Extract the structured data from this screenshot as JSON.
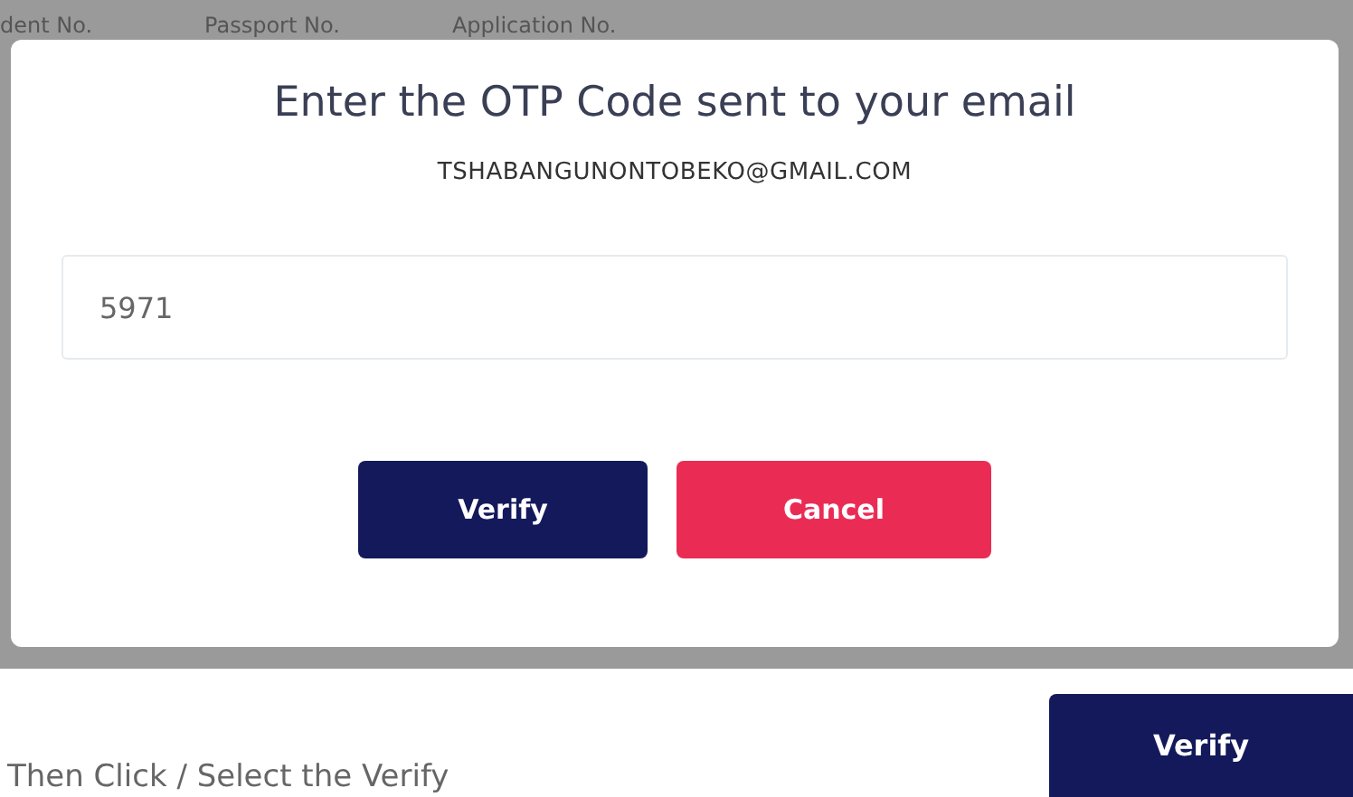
{
  "background_columns": [
    "dent No.",
    "Passport No.",
    "Application No."
  ],
  "dialog": {
    "title": "Enter the OTP Code sent to your email",
    "email": "TSHABANGUNONTOBEKO@GMAIL.COM",
    "otp_field": {
      "value": "5971"
    },
    "buttons": [
      {
        "label": "Verify",
        "kind": "primary"
      },
      {
        "label": "Cancel",
        "kind": "danger"
      }
    ]
  },
  "page_button": {
    "label": "Verify"
  },
  "instruction": "Then Click / Select the Verify"
}
